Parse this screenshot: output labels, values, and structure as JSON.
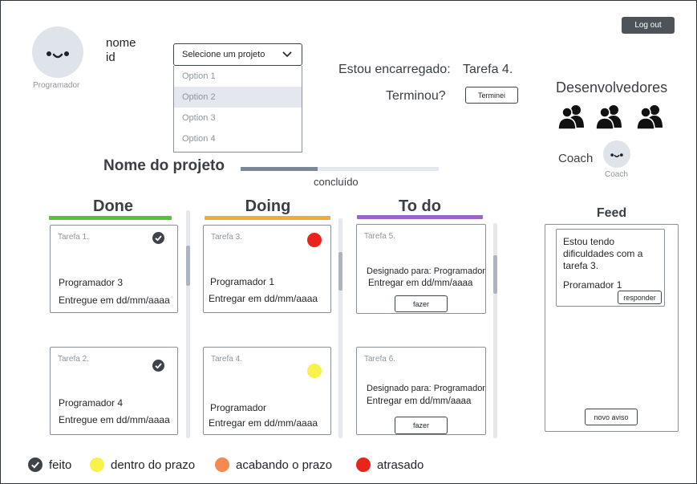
{
  "header": {
    "logout_label": "Log out",
    "user_name": "nome",
    "user_id": "id",
    "user_role": "Programador",
    "select_placeholder": "Selecione um projeto",
    "options": [
      "Option 1",
      "Option 2",
      "Option 3",
      "Option 4"
    ],
    "selected_option_index": 1,
    "in_charge_label": "Estou encarregado:",
    "in_charge_value": "Tarefa 4.",
    "finished_label": "Terminou?",
    "finished_button": "Terminei"
  },
  "project": {
    "name": "Nome do projeto",
    "progress_label": "concluído",
    "progress_fraction": 0.39
  },
  "team": {
    "title": "Desenvolvedores",
    "developer_count": 3,
    "coach_label": "Coach",
    "coach_caption": "Coach"
  },
  "columns": {
    "done": {
      "title": "Done",
      "color": "#55c238"
    },
    "doing": {
      "title": "Doing",
      "color": "#f5a83b"
    },
    "todo": {
      "title": "To do",
      "color": "#9b64c8"
    }
  },
  "cards": {
    "done_1": {
      "title": "Tarefa 1.",
      "line1": "Programador 3",
      "line2": "Entregue em dd/mm/aaaa",
      "status": "feito"
    },
    "done_2": {
      "title": "Tarefa 2.",
      "line1": "Programador 4",
      "line2": "Entregue em dd/mm/aaaa",
      "status": "feito"
    },
    "doing_1": {
      "title": "Tarefa 3.",
      "line1": "Programador 1",
      "line2": "Entregar em dd/mm/aaaa",
      "status": "atrasado"
    },
    "doing_2": {
      "title": "Tarefa 4.",
      "line1": "Programador",
      "line2": "Entregar em dd/mm/aaaa",
      "status": "dentro do prazo"
    },
    "todo_1": {
      "title": "Tarefa 5.",
      "line1": "Designado para: Programador",
      "line2": "Entregar em dd/mm/aaaa",
      "button": "fazer"
    },
    "todo_2": {
      "title": "Tarefa 6.",
      "line1": "Designado para: Programador",
      "line2": "Entregar em dd/mm/aaaa",
      "button": "fazer"
    }
  },
  "feed": {
    "title": "Feed",
    "message_text": "Estou tendo dificuldades com a tarefa 3.",
    "message_author": "Proramador 1",
    "reply_button": "responder",
    "new_notice_button": "novo aviso"
  },
  "legend": [
    {
      "label": "feito",
      "color": "#3d4349"
    },
    {
      "label": "dentro do prazo",
      "color": "#f8f24a"
    },
    {
      "label": "acabando o prazo",
      "color": "#f48a4f"
    },
    {
      "label": "atrasado",
      "color": "#e8241b"
    }
  ],
  "colors": {
    "check": "#3d4349",
    "on_time": "#f8f24a",
    "ending": "#f48a4f",
    "late": "#e8241b",
    "progress_fill": "#7c8794",
    "progress_track": "#e4e7ee"
  }
}
